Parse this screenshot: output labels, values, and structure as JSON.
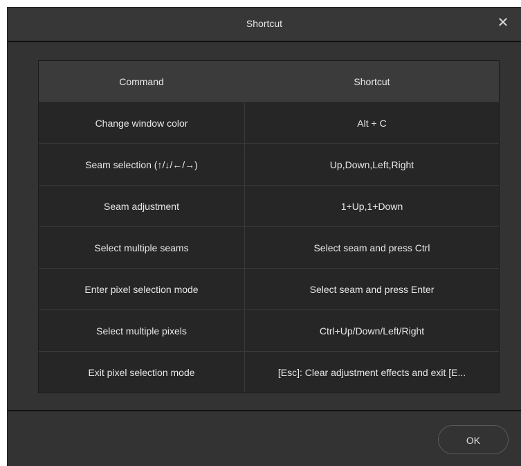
{
  "dialog": {
    "title": "Shortcut",
    "close_glyph": "✕",
    "ok_label": "OK"
  },
  "table": {
    "headers": [
      "Command",
      "Shortcut"
    ],
    "rows": [
      {
        "command": "Change window color",
        "shortcut": "Alt + C"
      },
      {
        "command": "Seam selection (↑/↓/←/→)",
        "shortcut": "Up,Down,Left,Right"
      },
      {
        "command": "Seam adjustment",
        "shortcut": "1+Up,1+Down"
      },
      {
        "command": "Select multiple seams",
        "shortcut": "Select seam and press Ctrl"
      },
      {
        "command": "Enter pixel selection mode",
        "shortcut": "Select seam and press Enter"
      },
      {
        "command": "Select multiple pixels",
        "shortcut": "Ctrl+Up/Down/Left/Right"
      },
      {
        "command": "Exit pixel selection mode",
        "shortcut": "[Esc]: Clear adjustment effects and exit [E..."
      }
    ]
  },
  "icons": {
    "close": "close-icon"
  },
  "colors": {
    "background": "#333333",
    "table_cell": "#262626",
    "table_header": "#3b3b3b",
    "text": "#e8e8e8"
  }
}
